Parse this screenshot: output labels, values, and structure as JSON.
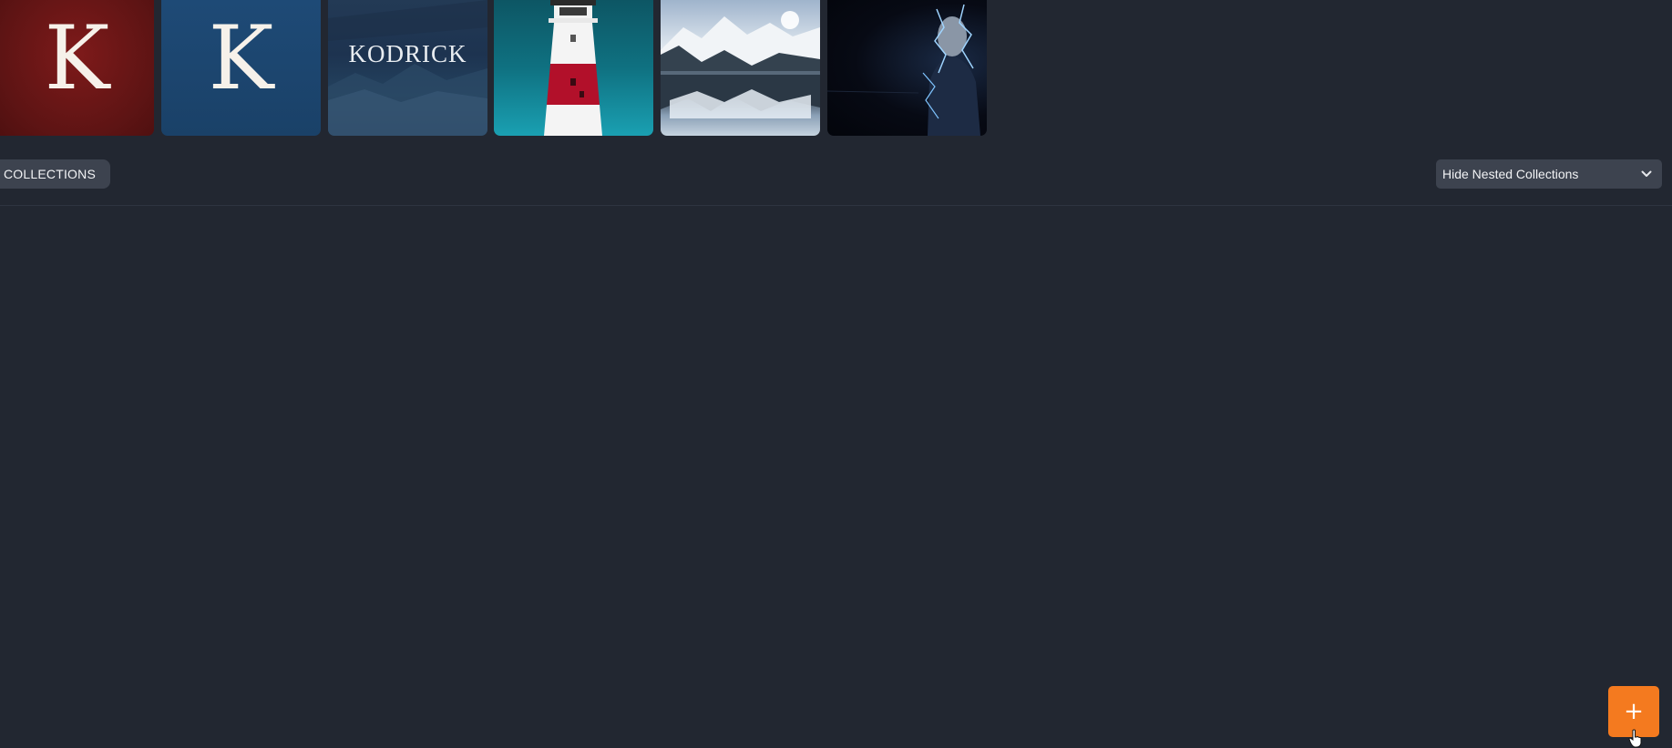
{
  "covers": [
    {
      "kind": "monogram",
      "text": "K",
      "background": "#6b1717"
    },
    {
      "kind": "monogram",
      "text": "K",
      "background": "#1d4570"
    },
    {
      "kind": "wordmark",
      "text": "KODRICK",
      "background": "#1f3852"
    },
    {
      "kind": "photo",
      "subject": "lighthouse",
      "background": "#0f6f7f"
    },
    {
      "kind": "photo",
      "subject": "mountain-lake",
      "background": "#8ea4ba"
    },
    {
      "kind": "photo",
      "subject": "lightning-portrait",
      "background": "#070a14"
    }
  ],
  "toolbar": {
    "collections_label": "COLLECTIONS",
    "nested_filter": {
      "selected": "Hide Nested Collections",
      "icon": "chevron-down-icon"
    }
  },
  "fab": {
    "label": "+",
    "color": "#f47a1f",
    "icon": "plus-icon"
  },
  "theme": {
    "background": "#222731",
    "control_background": "#3d434f",
    "divider": "#2e3440"
  }
}
